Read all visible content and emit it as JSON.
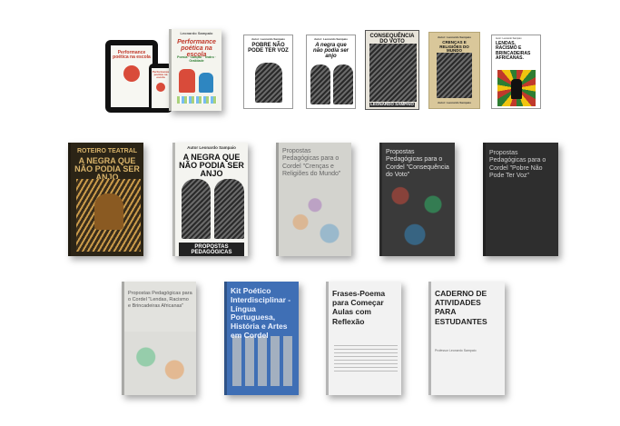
{
  "products": {
    "performance_bundle": {
      "brand_label": "Leonardo Sampaio",
      "title": "Performance poética na escola",
      "subtitle": "Poesia · Canção · Teatro · Oralidade"
    },
    "pobre": {
      "author": "Autor: Leonardo Sampaio",
      "title": "POBRE NÃO PODE TER VOZ"
    },
    "negra_small": {
      "author": "Autor: Leonardo Sampaio",
      "title": "A negra que não podia ser anjo"
    },
    "consequencia": {
      "title": "CONSEQUÊNCIA DO VOTO",
      "author": "LEONARDO SAMPAIO"
    },
    "crencas_small": {
      "author": "Autor: Leonardo Sampaio",
      "title": "CRENÇAS E RELIGIÕES DO MUNDO",
      "footer": "Autor: Leonardo Sampaio"
    },
    "lendas_small": {
      "author": "Autor: Leonardo Sampaio",
      "title": "LENDAS, RACISMO E BRINCADEIRAS AFRICANAS."
    },
    "roteiro": {
      "kicker": "ROTEIRO TEATRAL",
      "title": "A NEGRA QUE NÃO PODIA SER ANJO"
    },
    "negra_propostas": {
      "author": "Autor Leonardo Sampaio",
      "title": "A NEGRA QUE NÃO PODIA SER ANJO",
      "footer": "PROPOSTAS PEDAGÓGICAS"
    },
    "propostas_crencas": {
      "title": "Propostas Pedagógicas para o Cordel \"Crenças e Religiões do Mundo\""
    },
    "propostas_voto": {
      "title": "Propostas Pedagógicas para o Cordel \"Consequência do Voto\""
    },
    "propostas_pobre": {
      "title": "Propostas Pedagógicas para o Cordel \"Pobre Não Pode Ter Voz\""
    },
    "propostas_lendas": {
      "title": "Propostas Pedagógicas para o Cordel \"Lendas, Racismo e Brincadeiras Africanas\""
    },
    "kit": {
      "title": "Kit Poético Interdisciplinar - Língua Portuguesa, História e Artes em Cordel"
    },
    "frases": {
      "title": "Frases-Poema para Começar Aulas com Reflexão"
    },
    "caderno": {
      "title": "CADERNO DE ATIVIDADES PARA ESTUDANTES",
      "author": "Professor Leonardo Sampaio"
    }
  },
  "colors": {
    "kit_blue": "#3f6fb5",
    "dark_cover": "#3a3a3a",
    "wood_tan": "#d9c79a",
    "lendas_red": "#c0392b"
  }
}
